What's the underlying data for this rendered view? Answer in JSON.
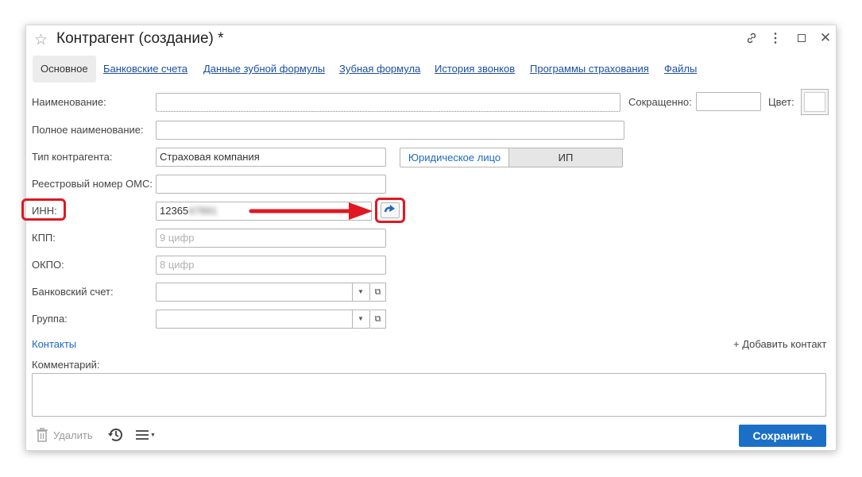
{
  "window": {
    "title": "Контрагент (создание) *"
  },
  "tabs": [
    {
      "label": "Основное",
      "active": true
    },
    {
      "label": "Банковские счета"
    },
    {
      "label": "Данные зубной формулы"
    },
    {
      "label": "Зубная формула"
    },
    {
      "label": "История звонков"
    },
    {
      "label": "Программы страхования"
    },
    {
      "label": "Файлы"
    }
  ],
  "form": {
    "name": {
      "label": "Наименование:",
      "value": ""
    },
    "short": {
      "label": "Сокращенно:",
      "value": ""
    },
    "color": {
      "label": "Цвет:"
    },
    "full_name": {
      "label": "Полное наименование:",
      "value": ""
    },
    "type": {
      "label": "Тип контрагента:",
      "value": "Страховая компания"
    },
    "entity": {
      "options": [
        "Юридическое лицо",
        "ИП"
      ],
      "selected": "ИП"
    },
    "oms": {
      "label": "Реестровый номер ОМС:",
      "value": ""
    },
    "inn": {
      "label": "ИНН:",
      "value_visible": "12365",
      "value_hidden": "47891"
    },
    "kpp": {
      "label": "КПП:",
      "placeholder": "9 цифр"
    },
    "okpo": {
      "label": "ОКПО:",
      "placeholder": "8 цифр"
    },
    "bank_account": {
      "label": "Банковский счет:",
      "value": ""
    },
    "group": {
      "label": "Группа:",
      "value": ""
    },
    "contacts": {
      "label": "Контакты",
      "add_label": "+ Добавить контакт"
    },
    "comment": {
      "label": "Комментарий:",
      "value": ""
    }
  },
  "footer": {
    "delete_label": "Удалить",
    "save_label": "Сохранить"
  },
  "colors": {
    "accent": "#1b6fc7",
    "link": "#1c4fa0",
    "highlight": "#e01822"
  }
}
